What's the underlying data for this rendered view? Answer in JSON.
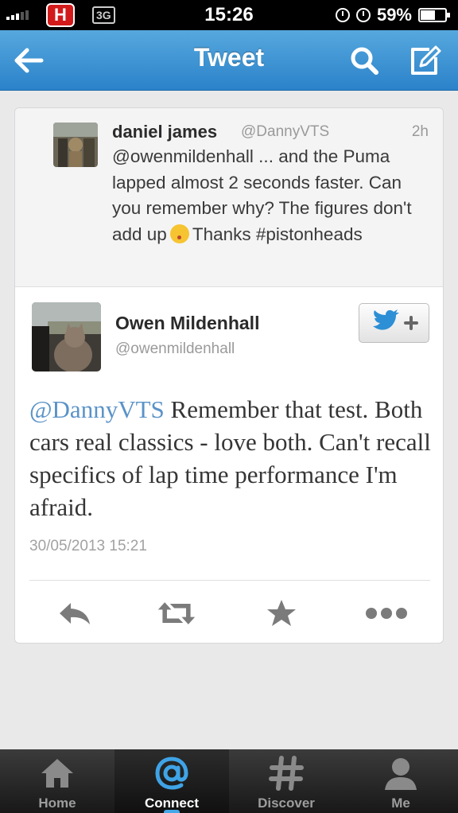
{
  "status_bar": {
    "network": "3G",
    "carrier_logo": "H",
    "time": "15:26",
    "battery": "59%"
  },
  "nav": {
    "title": "Tweet",
    "icons": [
      "back-arrow-icon",
      "search-icon",
      "compose-icon"
    ],
    "color": "#3a93d6"
  },
  "reply_tweet": {
    "name": "daniel james",
    "handle": "@DannyVTS",
    "time": "2h",
    "text_before_emoji": "@owenmildenhall ... and the Puma lapped almost 2 seconds faster. Can you remember why? The figures don't add up",
    "text_after_emoji": "Thanks #pistonheads"
  },
  "main_tweet": {
    "name": "Owen Mildenhall",
    "handle": "@owenmildenhall",
    "mention": "@DannyVTS",
    "text": " Remember that test. Both cars real classics - love both. Can't recall specifics of lap time performance I'm afraid.",
    "timestamp": "30/05/2013 15:21",
    "mention_color": "#5a93c8"
  },
  "actions": [
    "reply-icon",
    "retweet-icon",
    "favorite-icon",
    "more-icon"
  ],
  "tabs": [
    {
      "label": "Home",
      "icon": "home-icon",
      "active": false
    },
    {
      "label": "Connect",
      "icon": "at-icon",
      "active": true
    },
    {
      "label": "Discover",
      "icon": "hash-icon",
      "active": false
    },
    {
      "label": "Me",
      "icon": "person-icon",
      "active": false
    }
  ]
}
